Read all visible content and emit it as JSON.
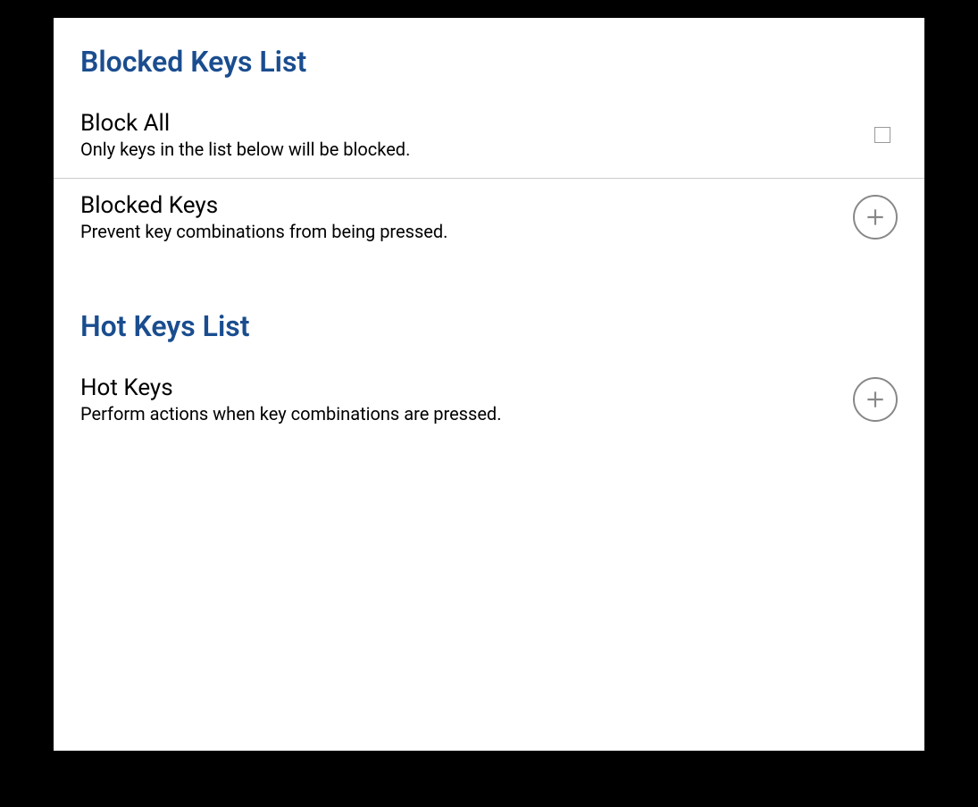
{
  "sections": {
    "blockedKeysList": {
      "title": "Blocked Keys List",
      "blockAll": {
        "title": "Block All",
        "subtitle": "Only keys in the list below will be blocked."
      },
      "blockedKeys": {
        "title": "Blocked Keys",
        "subtitle": "Prevent key combinations from being pressed."
      }
    },
    "hotKeysList": {
      "title": "Hot Keys List",
      "hotKeys": {
        "title": "Hot Keys",
        "subtitle": "Perform actions when key combinations are pressed."
      }
    }
  }
}
